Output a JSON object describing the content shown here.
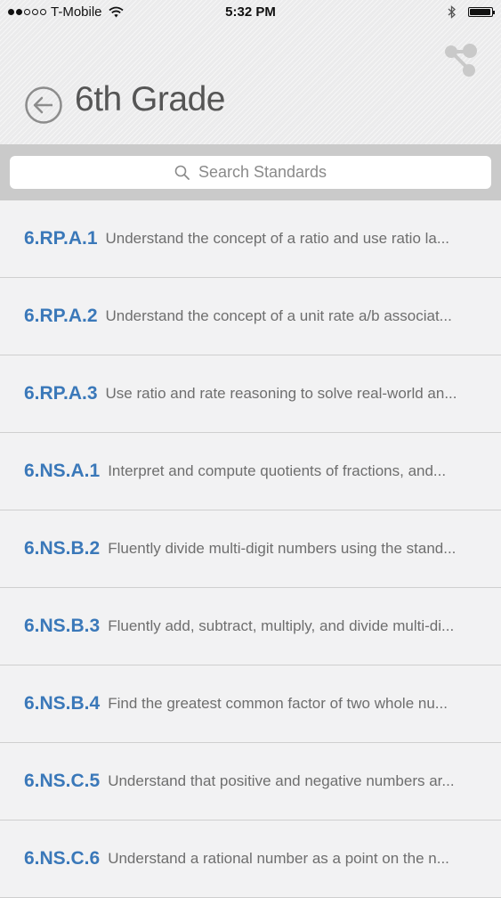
{
  "status_bar": {
    "carrier": "T-Mobile",
    "time": "5:32 PM",
    "signal_bars_filled": 2,
    "signal_bars_total": 5,
    "battery_level": 0.95
  },
  "header": {
    "title": "6th Grade",
    "back_icon": "back-arrow-circle-icon",
    "share_icon": "share-network-icon"
  },
  "search": {
    "placeholder": "Search Standards"
  },
  "colors": {
    "code_blue": "#3a78b9",
    "background": "#f2f2f3",
    "search_bar_bg": "#cacaca"
  },
  "standards": [
    {
      "code": "6.RP.A.1",
      "description": "Understand the concept of a ratio and use ratio la..."
    },
    {
      "code": "6.RP.A.2",
      "description": "Understand the concept of a unit rate a/b associat..."
    },
    {
      "code": "6.RP.A.3",
      "description": "Use ratio and rate reasoning to solve real-world an..."
    },
    {
      "code": "6.NS.A.1",
      "description": "Interpret and compute quotients of fractions, and..."
    },
    {
      "code": "6.NS.B.2",
      "description": "Fluently divide multi-digit numbers using the stand..."
    },
    {
      "code": "6.NS.B.3",
      "description": "Fluently add, subtract, multiply, and divide multi-di..."
    },
    {
      "code": "6.NS.B.4",
      "description": "Find the greatest common factor of two whole nu..."
    },
    {
      "code": "6.NS.C.5",
      "description": "Understand that positive and negative numbers ar..."
    },
    {
      "code": "6.NS.C.6",
      "description": "Understand a rational number as a point on the n..."
    }
  ]
}
